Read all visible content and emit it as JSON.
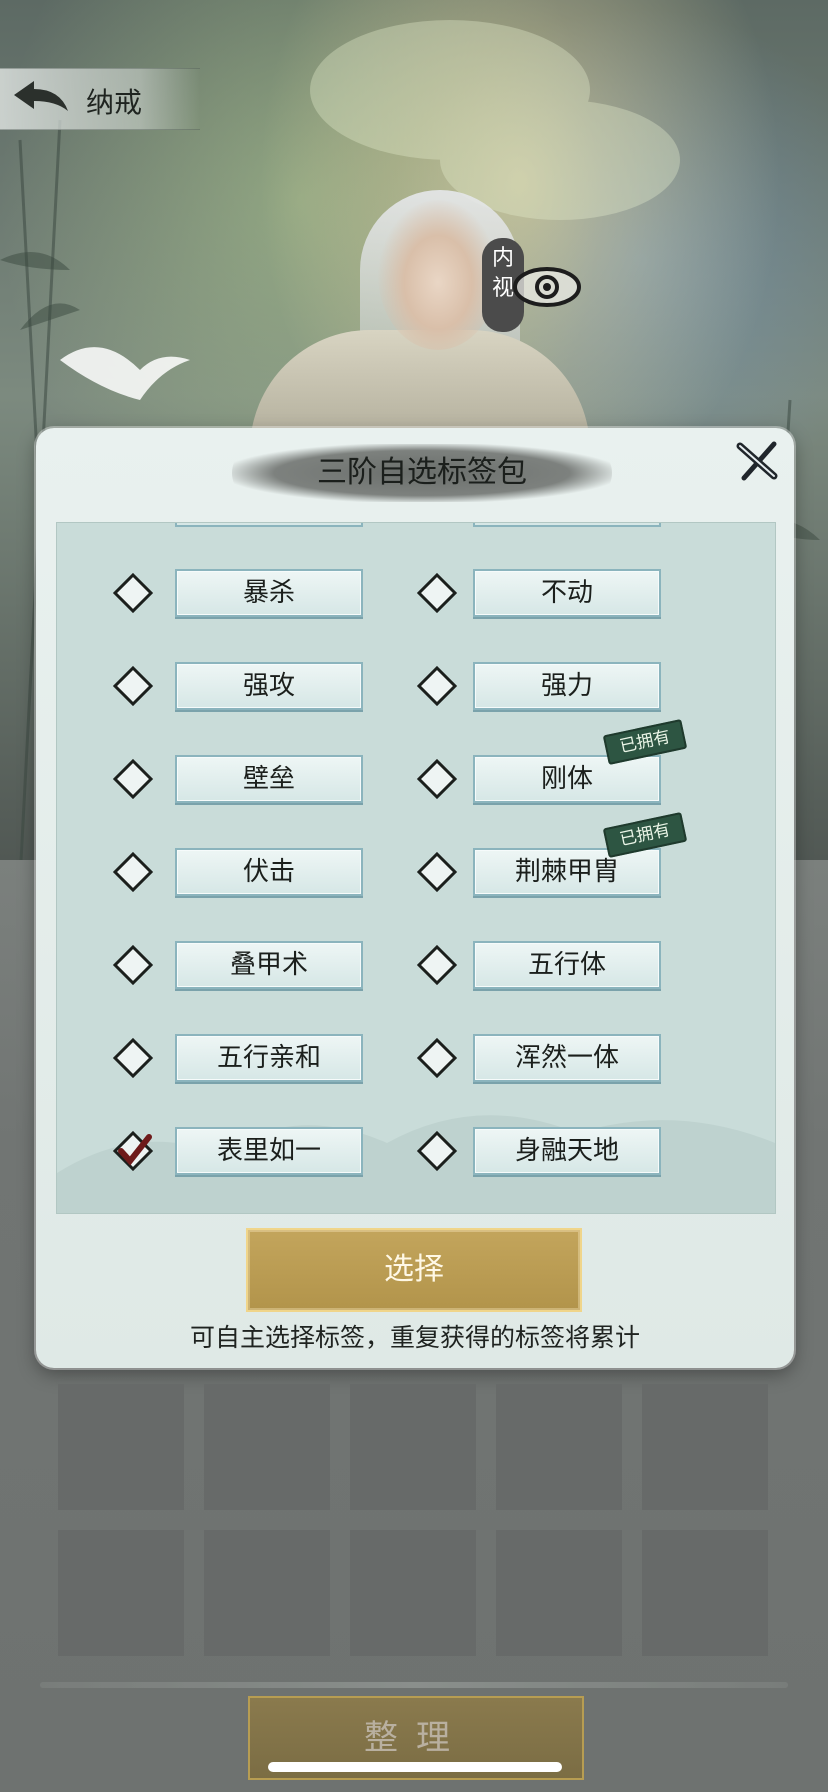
{
  "header": {
    "back_icon": "back-arrow-icon",
    "title": "纳戒"
  },
  "character": {
    "insight_label": "内视",
    "eye_icon": "eye-icon"
  },
  "modal": {
    "title": "三阶自选标签包",
    "close_icon": "close-x-icon",
    "rows": [
      {
        "left": {
          "label": "暴杀",
          "checked": false,
          "owned": false
        },
        "right": {
          "label": "不动",
          "checked": false,
          "owned": false
        }
      },
      {
        "left": {
          "label": "强攻",
          "checked": false,
          "owned": false
        },
        "right": {
          "label": "强力",
          "checked": false,
          "owned": false
        }
      },
      {
        "left": {
          "label": "壁垒",
          "checked": false,
          "owned": false
        },
        "right": {
          "label": "刚体",
          "checked": false,
          "owned": true
        }
      },
      {
        "left": {
          "label": "伏击",
          "checked": false,
          "owned": false
        },
        "right": {
          "label": "荆棘甲胄",
          "checked": false,
          "owned": true
        }
      },
      {
        "left": {
          "label": "叠甲术",
          "checked": false,
          "owned": false
        },
        "right": {
          "label": "五行体",
          "checked": false,
          "owned": false
        }
      },
      {
        "left": {
          "label": "五行亲和",
          "checked": false,
          "owned": false
        },
        "right": {
          "label": "浑然一体",
          "checked": false,
          "owned": false
        }
      },
      {
        "left": {
          "label": "表里如一",
          "checked": true,
          "owned": false
        },
        "right": {
          "label": "身融天地",
          "checked": false,
          "owned": false
        }
      }
    ],
    "owned_badge": "已拥有",
    "select_button": "选择",
    "hint": "可自主选择标签，重复获得的标签将累计"
  },
  "inventory": {
    "sort_button": "整理"
  },
  "colors": {
    "tag_border": "#8bb4bd",
    "gold_button": "#c3a55c",
    "panel_bg": "#c9dcd9"
  }
}
